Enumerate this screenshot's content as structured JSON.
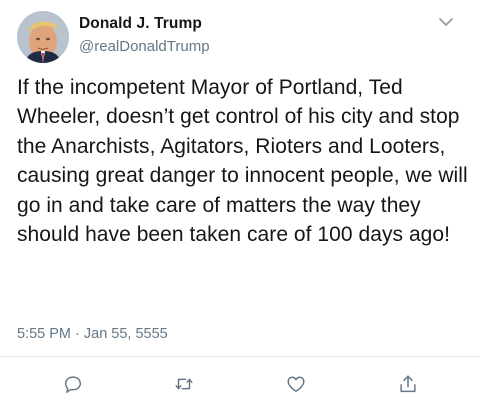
{
  "author": {
    "display_name": "Donald J. Trump",
    "handle": "@realDonaldTrump"
  },
  "tweet": {
    "text": "If the incompetent Mayor of Portland, Ted Wheeler, doesn’t get control of his city and stop the Anarchists, Agitators, Rioters and Looters, causing great danger to innocent people, we will go in and take care of matters the way they should have been taken care of 100 days ago!",
    "timestamp": "5:55 PM · Jan 55, 5555"
  },
  "icons": {
    "menu": "chevron-down-icon",
    "reply": "reply-icon",
    "retweet": "retweet-icon",
    "like": "heart-icon",
    "share": "share-icon"
  },
  "colors": {
    "text": "#14171a",
    "secondary": "#657786",
    "icon": "#657786",
    "divider": "#e6ecf0"
  }
}
